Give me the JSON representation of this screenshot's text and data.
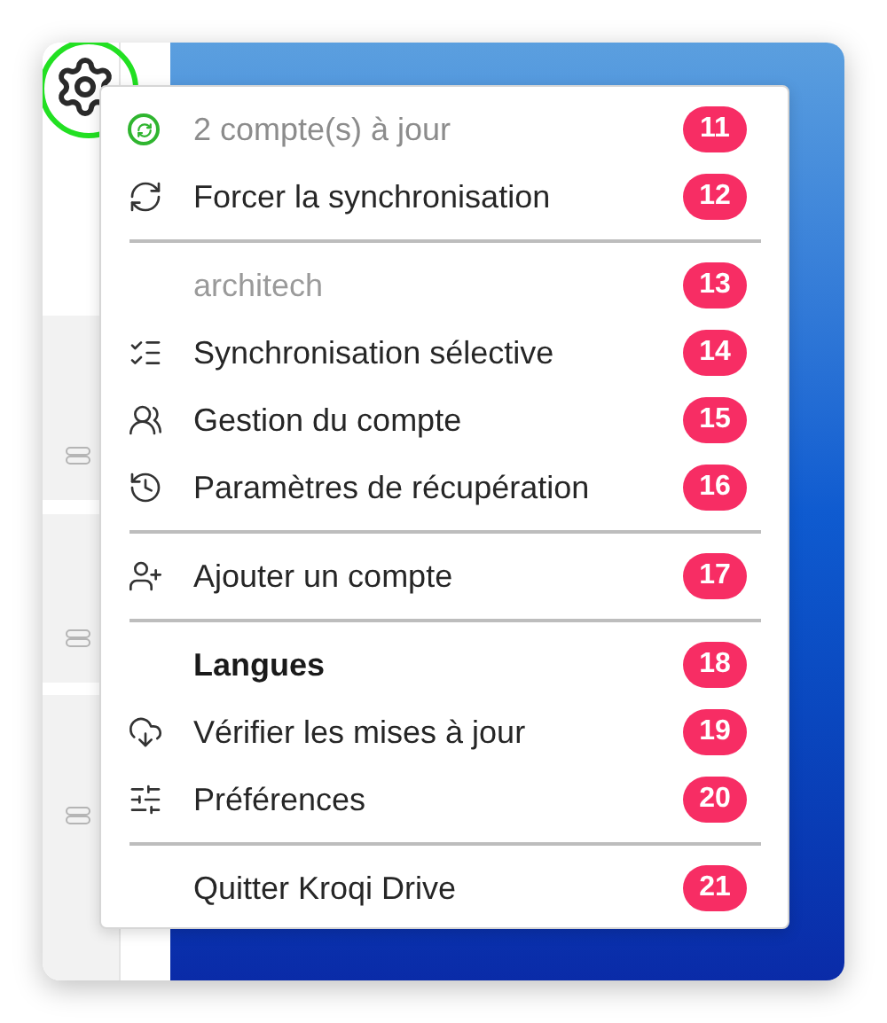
{
  "settings_button": {
    "highlighted": true
  },
  "menu": {
    "entries": [
      {
        "kind": "status",
        "label": "2 compte(s) à jour",
        "badge": "11"
      },
      {
        "kind": "action",
        "label": "Forcer la synchronisation",
        "badge": "12"
      },
      {
        "kind": "separator"
      },
      {
        "kind": "header",
        "label": "architech",
        "badge": "13"
      },
      {
        "kind": "action",
        "label": "Synchronisation sélective",
        "badge": "14"
      },
      {
        "kind": "action",
        "label": "Gestion du compte",
        "badge": "15"
      },
      {
        "kind": "action",
        "label": "Paramètres de récupération",
        "badge": "16"
      },
      {
        "kind": "separator"
      },
      {
        "kind": "action",
        "label": "Ajouter un compte",
        "badge": "17"
      },
      {
        "kind": "separator"
      },
      {
        "kind": "submenu",
        "label": "Langues",
        "badge": "18"
      },
      {
        "kind": "action",
        "label": "Vérifier les mises à jour",
        "badge": "19"
      },
      {
        "kind": "action",
        "label": "Préférences",
        "badge": "20"
      },
      {
        "kind": "separator"
      },
      {
        "kind": "action",
        "label": "Quitter Kroqi Drive",
        "badge": "21"
      }
    ]
  }
}
